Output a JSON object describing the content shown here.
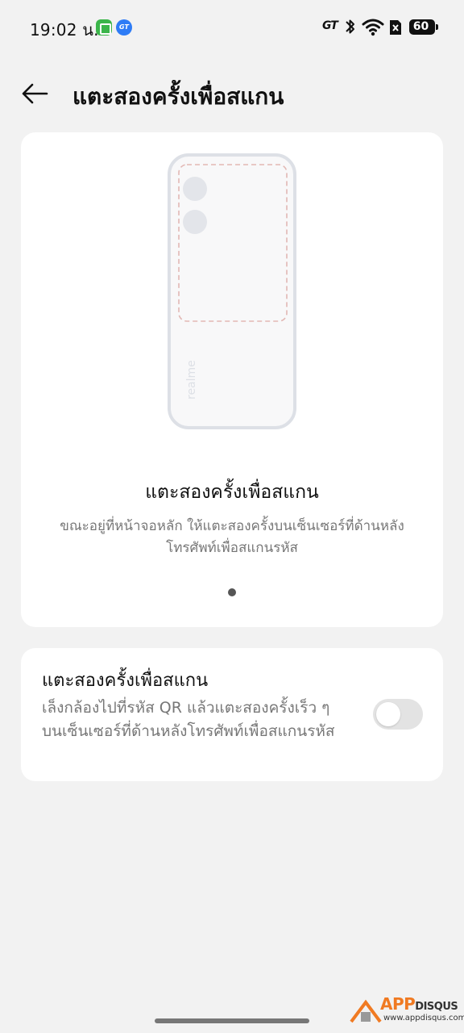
{
  "status_bar": {
    "time": "19:02 น.",
    "carrier_badge": "GT",
    "gt_mark": "GT",
    "battery": "60",
    "icons": [
      "app-store-icon",
      "gt-mode-icon",
      "bluetooth-icon",
      "wifi-icon",
      "no-sim-icon",
      "battery-icon"
    ]
  },
  "header": {
    "title": "แตะสองครั้งเพื่อสแกน",
    "back_icon": "back-arrow-icon"
  },
  "hero": {
    "illustration_brand": "realme",
    "title": "แตะสองครั้งเพื่อสแกน",
    "description": "ขณะอยู่ที่หน้าจอหลัก ให้แตะสองครั้งบนเซ็นเซอร์ที่ด้านหลังโทรศัพท์เพื่อสแกนรหัส"
  },
  "setting": {
    "title": "แตะสองครั้งเพื่อสแกน",
    "description": "เล็งกล้องไปที่รหัส QR แล้วแตะสองครั้งเร็ว ๆ บนเซ็นเซอร์ที่ด้านหลังโทรศัพท์เพื่อสแกนรหัส",
    "enabled": false
  },
  "watermark": {
    "brand_main": "APP",
    "brand_secondary": "DISQUS",
    "url": "www.appdisqus.com"
  },
  "colors": {
    "background": "#f2f2f2",
    "card": "#ffffff",
    "toggle_off": "#e3e3e3",
    "watermark_orange": "#f07a22"
  }
}
